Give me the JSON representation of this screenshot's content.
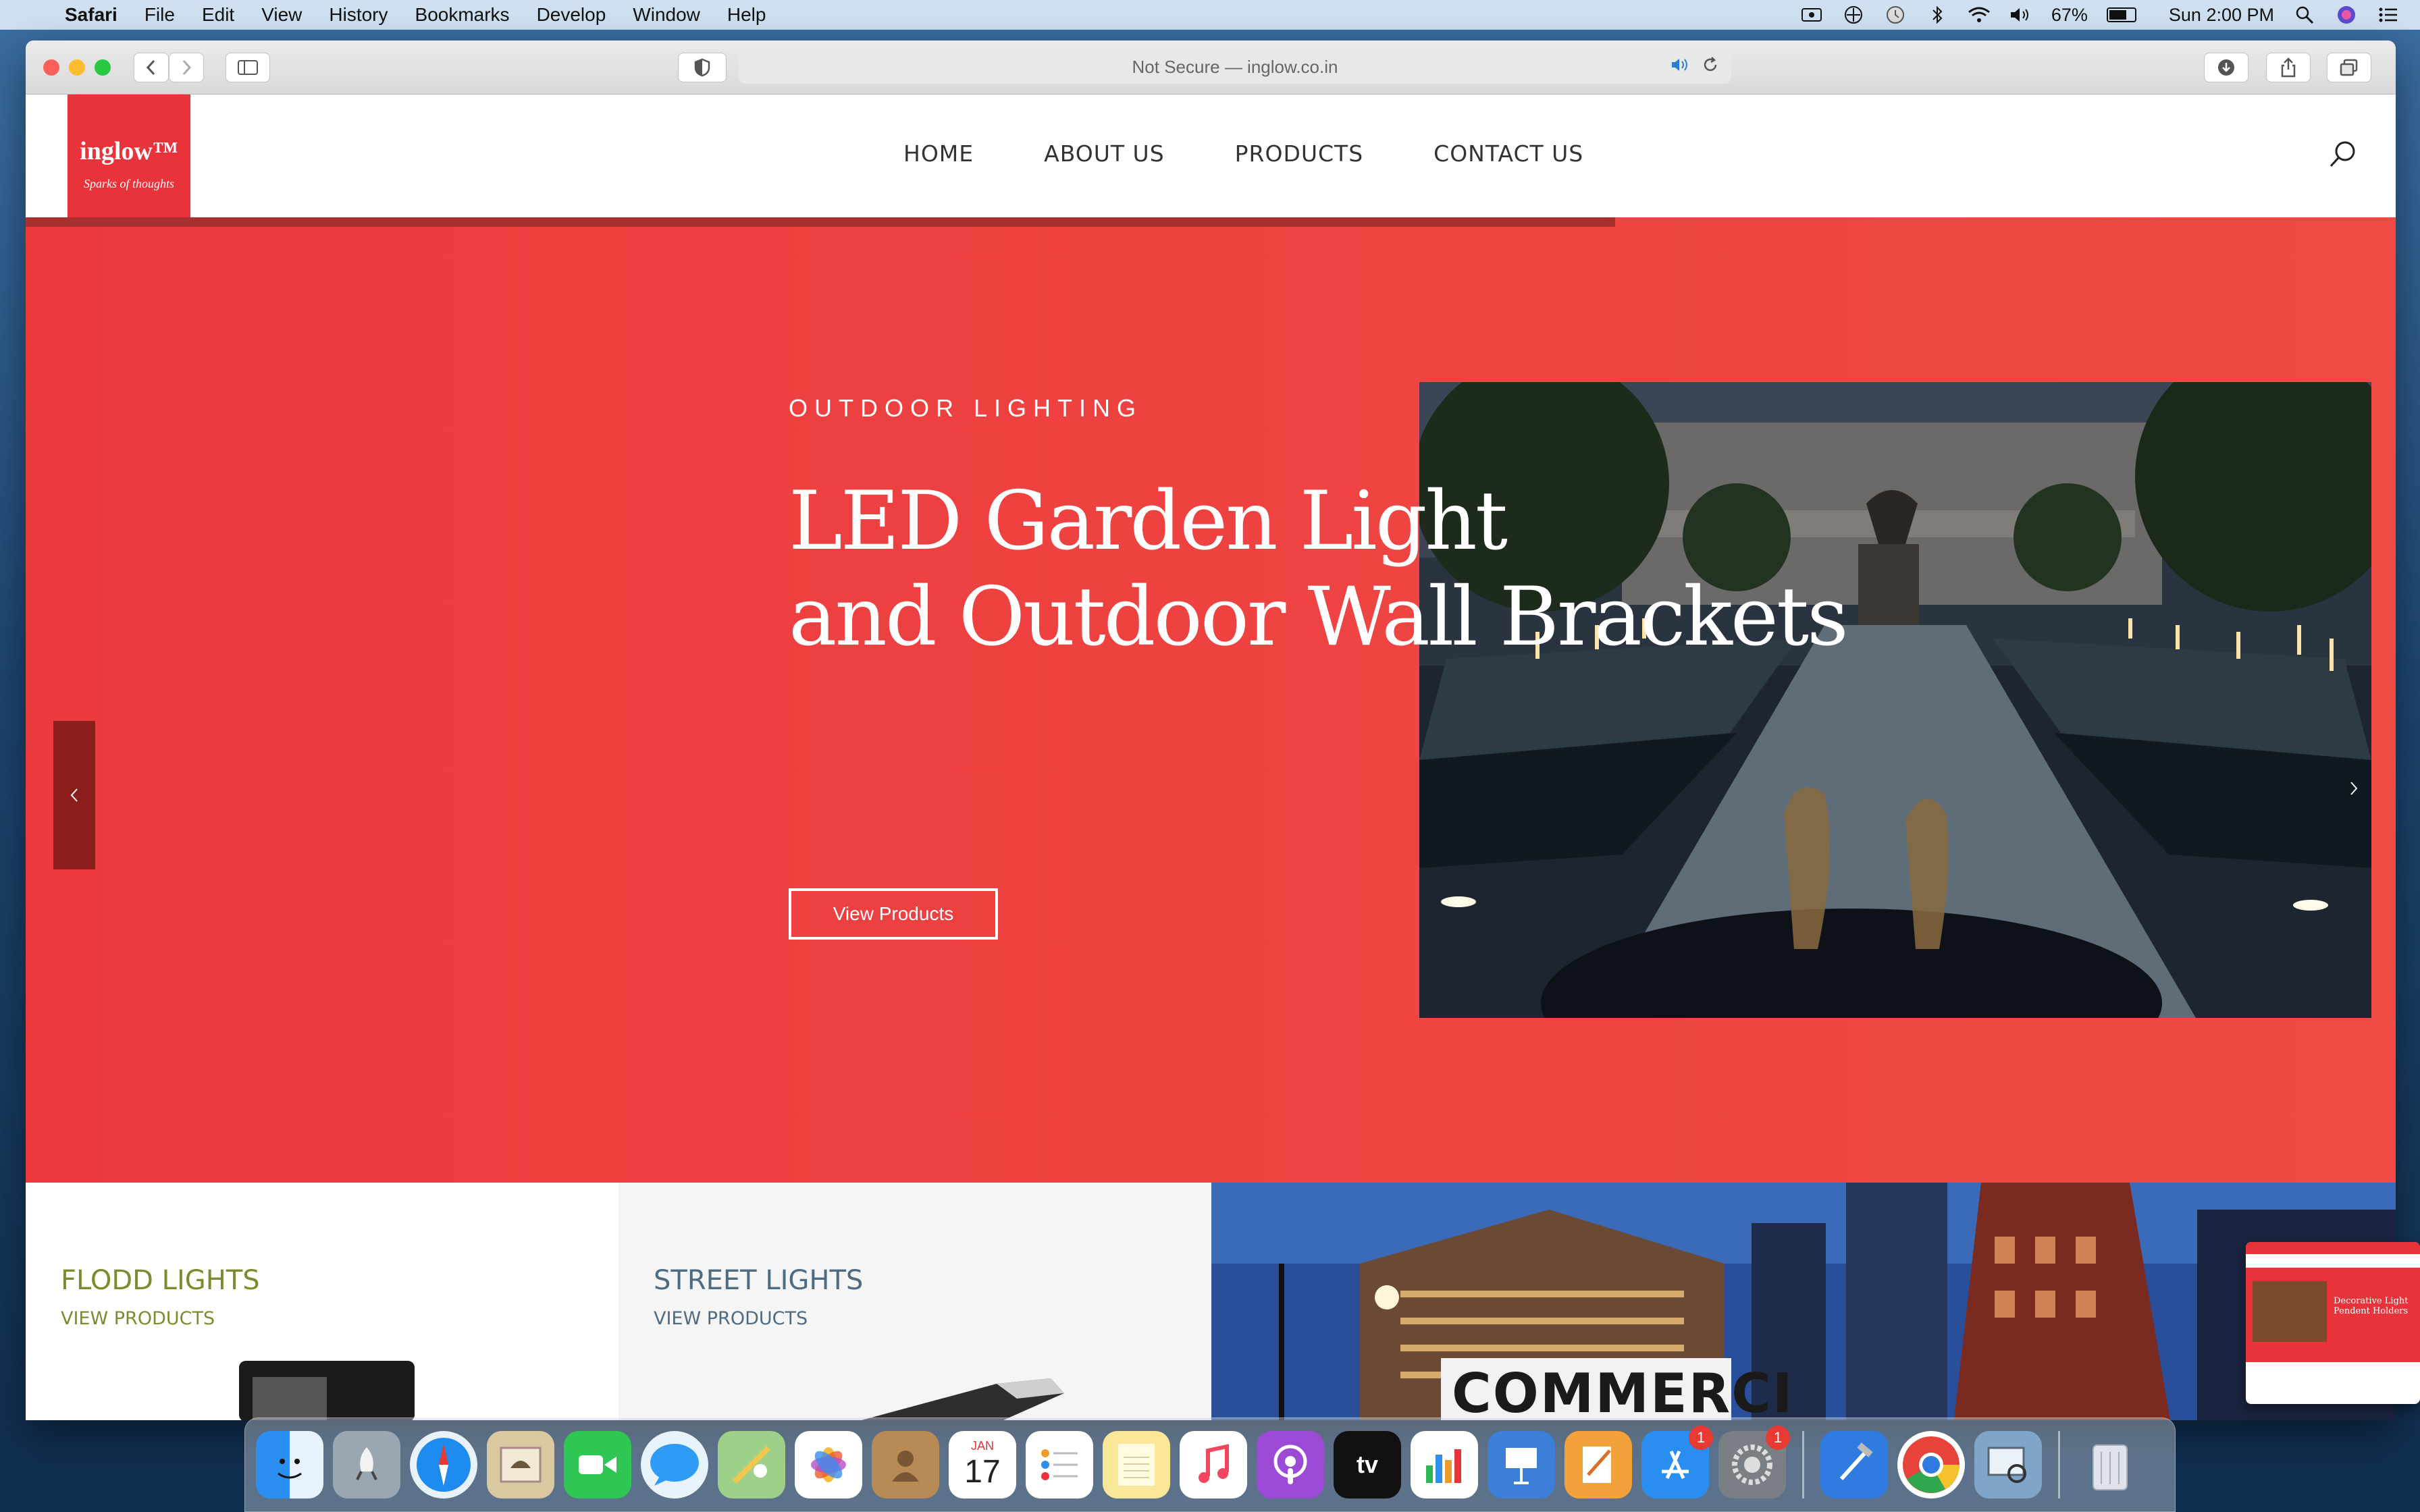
{
  "menubar": {
    "app": "Safari",
    "items": [
      "File",
      "Edit",
      "View",
      "History",
      "Bookmarks",
      "Develop",
      "Window",
      "Help"
    ],
    "battery": "67%",
    "battery_level": 0.67,
    "clock": "Sun 2:00 PM"
  },
  "browser": {
    "address": "Not Secure — inglow.co.in"
  },
  "site": {
    "logo_name": "inglow™",
    "logo_tagline": "Sparks of thoughts",
    "nav": [
      "HOME",
      "ABOUT US",
      "PRODUCTS",
      "CONTACT US"
    ],
    "hero": {
      "eyebrow": "OUTDOOR LIGHTING",
      "title_line1": "LED Garden Light",
      "title_line2": "and Outdoor Wall Brackets",
      "cta": "View Products"
    },
    "cards": [
      {
        "title": "FLODD LIGHTS",
        "link": "VIEW PRODUCTS"
      },
      {
        "title": "STREET LIGHTS",
        "link": "VIEW PRODUCTS"
      },
      {
        "title": "COMMERCI"
      }
    ]
  },
  "dock": {
    "calendar_month": "JAN",
    "calendar_day": "17",
    "appstore_badge": "1",
    "settings_badge": "1",
    "tv_label": "tv"
  },
  "thumbnail": {
    "title": "Decorative Light Pendent Holders"
  }
}
